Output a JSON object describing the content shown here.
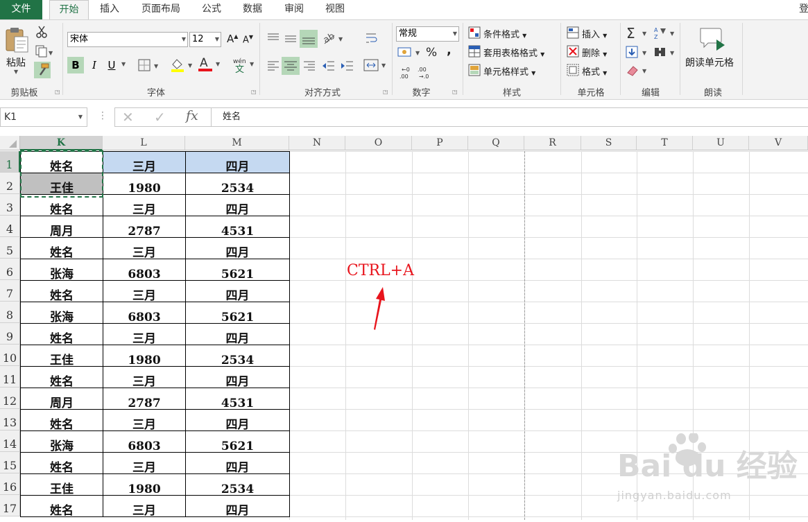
{
  "tabs": [
    {
      "label": "文件"
    },
    {
      "label": "开始"
    },
    {
      "label": "插入"
    },
    {
      "label": "页面布局"
    },
    {
      "label": "公式"
    },
    {
      "label": "数据"
    },
    {
      "label": "审阅"
    },
    {
      "label": "视图"
    }
  ],
  "tabs_truncated": "登",
  "ribbon": {
    "clipboard": {
      "paste": "粘贴",
      "group": "剪贴板"
    },
    "font": {
      "name": "宋体",
      "size": "12",
      "bold": "B",
      "italic": "I",
      "underline": "U",
      "color_a": "A",
      "group": "字体",
      "phonetic": "wén"
    },
    "align": {
      "group": "对齐方式"
    },
    "number": {
      "format": "常规",
      "percent": "%",
      "comma": ",",
      "group": "数字"
    },
    "styles": {
      "conditional": "条件格式",
      "table": "套用表格格式",
      "cell": "单元格样式",
      "group": "样式"
    },
    "cells": {
      "insert": "插入",
      "delete": "删除",
      "format": "格式",
      "group": "单元格"
    },
    "edit": {
      "group": "编辑"
    },
    "read": {
      "button": "朗读单元格",
      "group": "朗读"
    }
  },
  "formula_bar": {
    "name_box": "K1",
    "fx": "fx",
    "content": "姓名"
  },
  "columns": [
    "K",
    "L",
    "M",
    "N",
    "O",
    "P",
    "Q",
    "R",
    "S",
    "T",
    "U",
    "V"
  ],
  "rows": [
    "1",
    "2",
    "3",
    "4",
    "5",
    "6",
    "7",
    "8",
    "9",
    "10",
    "11",
    "12",
    "13",
    "14",
    "15",
    "16",
    "17"
  ],
  "table": [
    [
      "姓名",
      "三月",
      "四月"
    ],
    [
      "王佳",
      "1980",
      "2534"
    ],
    [
      "姓名",
      "三月",
      "四月"
    ],
    [
      "周月",
      "2787",
      "4531"
    ],
    [
      "姓名",
      "三月",
      "四月"
    ],
    [
      "张海",
      "6803",
      "5621"
    ],
    [
      "姓名",
      "三月",
      "四月"
    ],
    [
      "张海",
      "6803",
      "5621"
    ],
    [
      "姓名",
      "三月",
      "四月"
    ],
    [
      "王佳",
      "1980",
      "2534"
    ],
    [
      "姓名",
      "三月",
      "四月"
    ],
    [
      "周月",
      "2787",
      "4531"
    ],
    [
      "姓名",
      "三月",
      "四月"
    ],
    [
      "张海",
      "6803",
      "5621"
    ],
    [
      "姓名",
      "三月",
      "四月"
    ],
    [
      "王佳",
      "1980",
      "2534"
    ],
    [
      "姓名",
      "三月",
      "四月"
    ]
  ],
  "annotation": "CTRL+A",
  "watermark": {
    "brand": "Bai du 经验",
    "url": "jingyan.baidu.com"
  },
  "colors": {
    "accent": "#217346",
    "header_fill": "#c5d9f1",
    "annotation": "#e8141c"
  }
}
